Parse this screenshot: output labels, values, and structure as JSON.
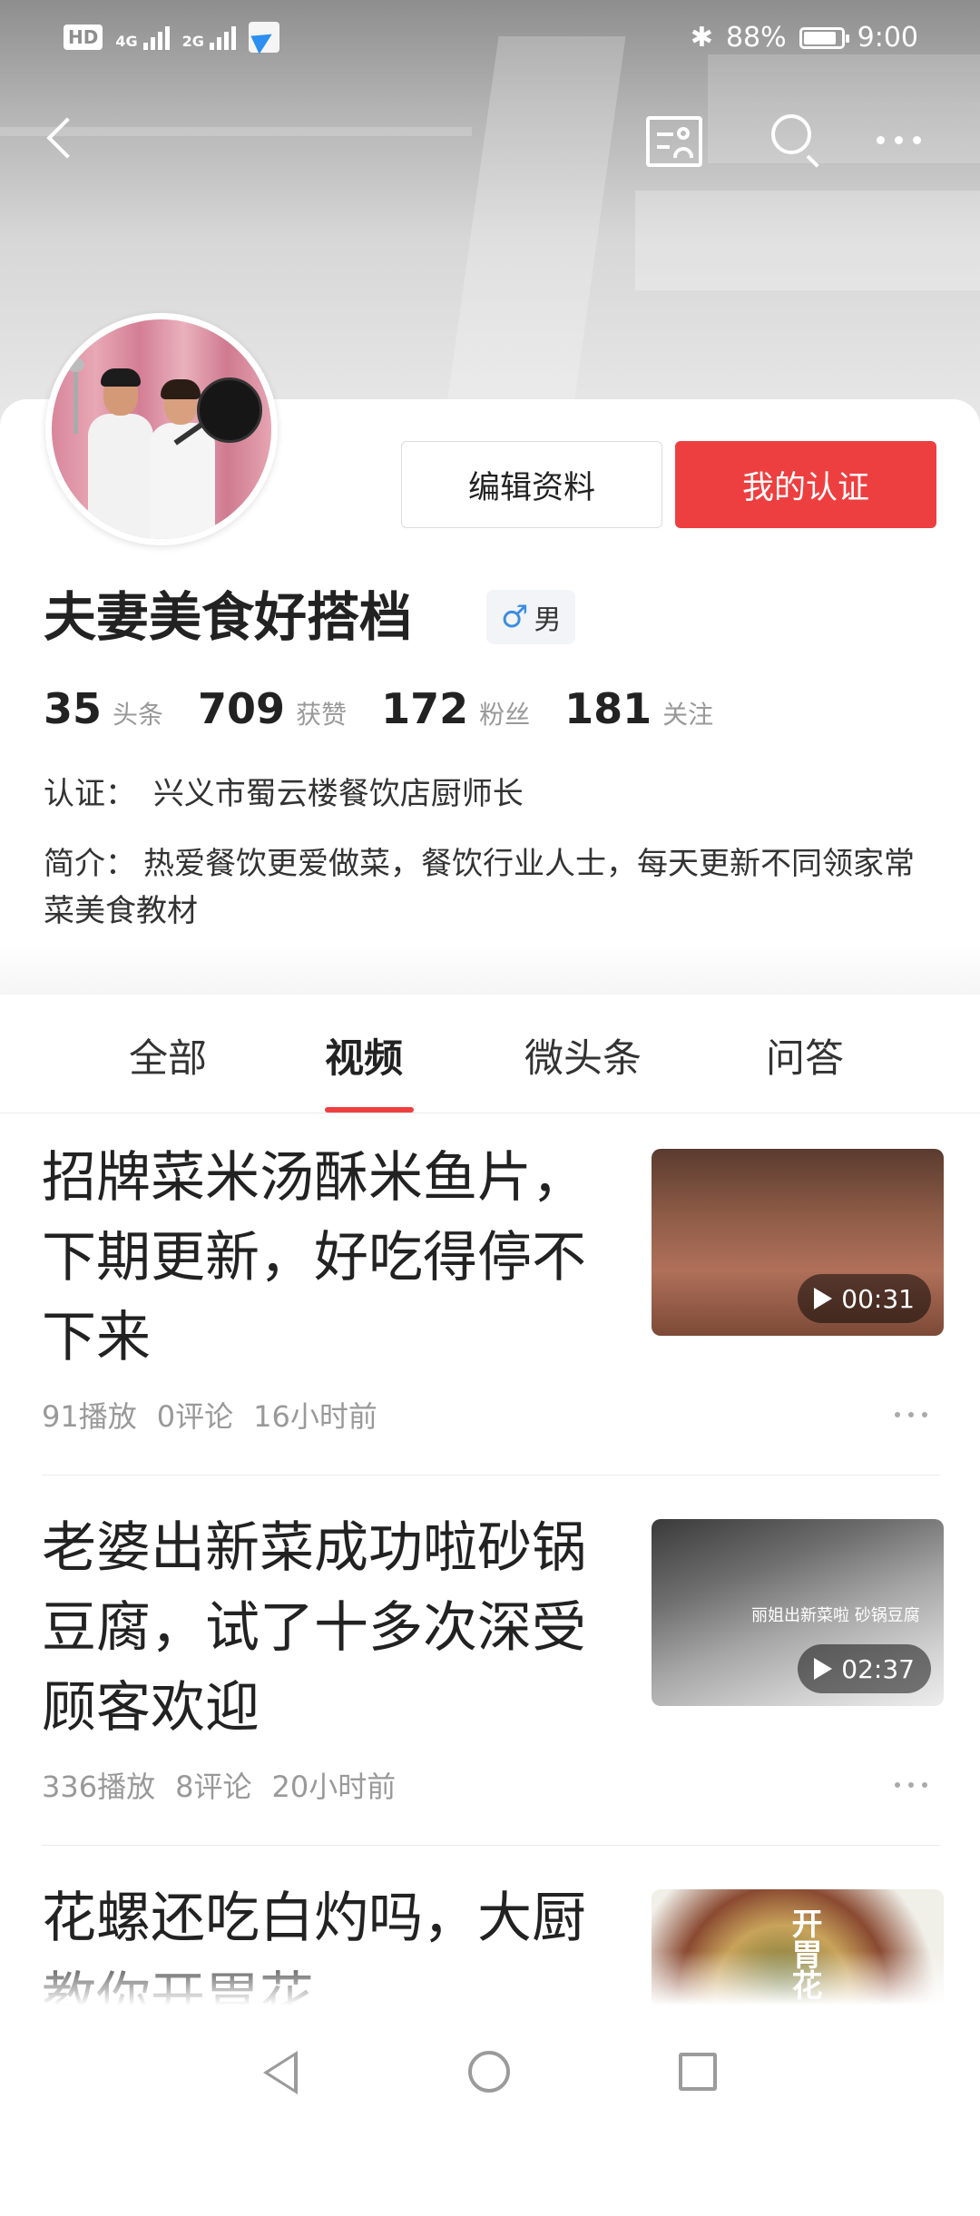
{
  "status_bar": {
    "hd": "HD",
    "net1": "4G",
    "net2": "2G",
    "battery_percent": "88%",
    "battery_level": 0.88,
    "time": "9:00"
  },
  "nav": {
    "icons": [
      "back-icon",
      "profile-card-icon",
      "search-icon",
      "more-icon"
    ]
  },
  "profile": {
    "edit_button": "编辑资料",
    "verify_button": "我的认证",
    "name": "夫妻美食好搭档",
    "gender_symbol": "♂",
    "gender": "男",
    "stats": [
      {
        "num": "35",
        "label": "头条"
      },
      {
        "num": "709",
        "label": "获赞"
      },
      {
        "num": "172",
        "label": "粉丝"
      },
      {
        "num": "181",
        "label": "关注"
      }
    ],
    "cert_label": "认证：",
    "cert_value": "兴义市蜀云楼餐饮店厨师长",
    "bio_label": "简介：",
    "bio_value": "热爱餐饮更爱做菜，餐饮行业人士，每天更新不同领家常菜美食教材"
  },
  "tabs": [
    "全部",
    "视频",
    "微头条",
    "问答"
  ],
  "active_tab": "视频",
  "feed": [
    {
      "title": "招牌菜米汤酥米鱼片，下期更新，好吃得停不下来",
      "plays": "91播放",
      "comments": "0评论",
      "time": "16小时前",
      "duration": "00:31"
    },
    {
      "title": "老婆出新菜成功啦砂锅豆腐，试了十多次深受顾客欢迎",
      "plays": "336播放",
      "comments": "8评论",
      "time": "20小时前",
      "duration": "02:37",
      "thumb_caption": "丽姐出新菜啦 砂锅豆腐"
    },
    {
      "title": "花螺还吃白灼吗，大厨教你开胃花",
      "thumb_caption": "开胃花"
    }
  ],
  "colors": {
    "accent": "#ee3f40",
    "muted_text": "#999999",
    "gender_blue": "#3c8dde"
  }
}
